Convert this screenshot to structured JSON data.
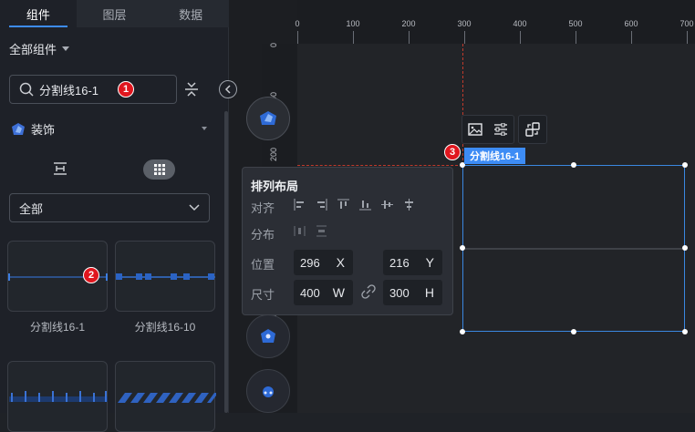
{
  "tabs": [
    "组件",
    "图层",
    "数据"
  ],
  "all_components_label": "全部组件",
  "search": {
    "value": "分割线16-1",
    "badge": "1"
  },
  "category": {
    "label": "装饰"
  },
  "filter_select": {
    "value": "全部"
  },
  "cards": [
    {
      "label": "分割线16-1",
      "badge": "2"
    },
    {
      "label": "分割线16-10"
    },
    {
      "label": ""
    },
    {
      "label": ""
    }
  ],
  "ruler_top_ticks": [
    "0",
    "100",
    "200",
    "300",
    "400",
    "500",
    "600",
    "700"
  ],
  "ruler_left_ticks": [
    "0",
    "100",
    "200",
    "500",
    "600"
  ],
  "layout_popup": {
    "title": "排列布局",
    "align_label": "对齐",
    "distribute_label": "分布",
    "position_label": "位置",
    "size_label": "尺寸",
    "x_value": "296",
    "x_axis": "X",
    "y_value": "216",
    "y_axis": "Y",
    "w_value": "400",
    "w_axis": "W",
    "h_value": "300",
    "h_axis": "H"
  },
  "selection": {
    "label": "分割线16-1",
    "badge": "3"
  },
  "colors": {
    "accent": "#3d8cf5",
    "badge": "#e0161e",
    "guide": "#c0392b"
  }
}
